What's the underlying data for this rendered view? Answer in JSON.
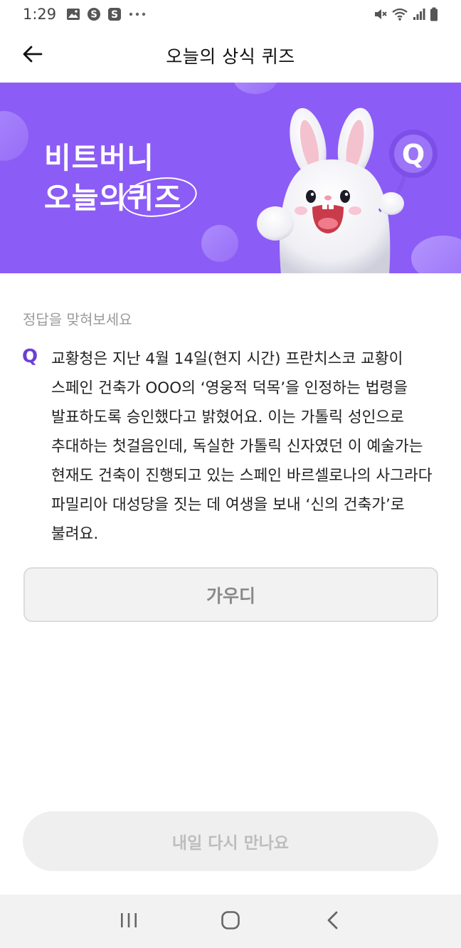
{
  "status_bar": {
    "time": "1:29",
    "left_icons": [
      "image-icon",
      "s-circle-icon",
      "s-app-icon",
      "more-dots-icon"
    ],
    "right_icons": [
      "mute-icon",
      "wifi-icon",
      "signal-icon",
      "battery-icon"
    ]
  },
  "header": {
    "title": "오늘의 상식 퀴즈",
    "back_icon": "arrow-left-icon"
  },
  "banner": {
    "line1": "비트버니",
    "line2_prefix": "오늘의",
    "line2_highlight": "퀴즈",
    "background_color": "#8c5cf6",
    "badge_letter": "Q"
  },
  "quiz": {
    "prompt": "정답을 맞혀보세요",
    "q_label": "Q",
    "question": "교황청은 지난 4월 14일(현지 시간) 프란치스코 교황이 스페인 건축가 OOO의 ‘영웅적 덕목’을 인정하는 법령을 발표하도록 승인했다고 밝혔어요. 이는 가톨릭 성인으로 추대하는 첫걸음인데, 독실한 가톨릭 신자였던 이 예술가는 현재도 건축이 진행되고 있는 스페인 바르셀로나의 사그라다 파밀리아 대성당을 짓는 데 여생을 보내 ‘신의 건축가’로 불려요.",
    "answer": "가우디",
    "accent_color": "#6b3fd6"
  },
  "footer": {
    "next_label": "내일 다시 만나요"
  },
  "nav_bar": {
    "icons": [
      "recent-apps-icon",
      "home-icon",
      "back-nav-icon"
    ]
  }
}
